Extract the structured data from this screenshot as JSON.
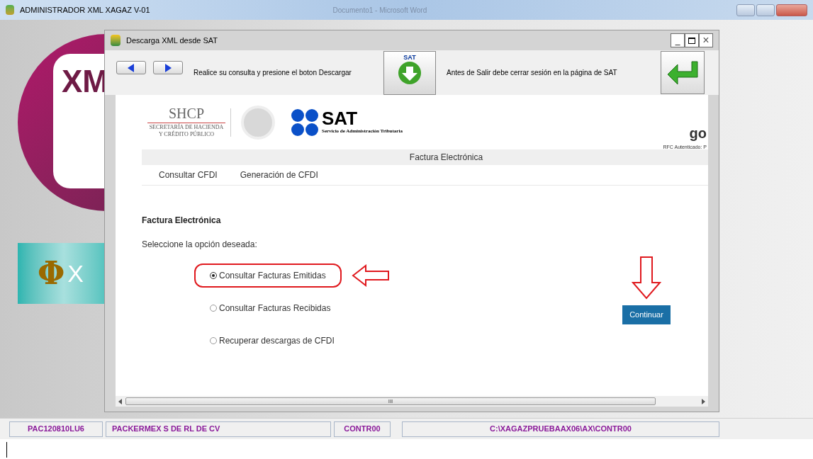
{
  "main_window": {
    "title": "ADMINISTRADOR XML XAGAZ V-01",
    "background_title": "Documento1 - Microsoft Word",
    "logo_text": "XM",
    "logo2_text": "X",
    "logo2_symbol": "Φ"
  },
  "dialog": {
    "title": "Descarga  XML desde SAT",
    "minimize": "_",
    "close": "×",
    "toolbar_hint": "Realice su consulta y presione el boton Descargar",
    "download_label": "SAT",
    "logout_hint": "Antes de Salir debe cerrar sesión en la página de SAT"
  },
  "web": {
    "shcp": "SHCP",
    "shcp_sub": "SECRETARÍA DE HACIENDA Y CRÉDITO PÚBLICO",
    "sat": "SAT",
    "sat_sub": "Servicio de Administración Tributaria",
    "cut_text": "go",
    "bar_title": "Factura Electrónica",
    "rfc": "RFC Autenticado: P",
    "menu": [
      {
        "label": "Consultar CFDI"
      },
      {
        "label": "Generación de CFDI"
      }
    ],
    "heading": "Factura Electrónica",
    "prompt": "Seleccione la opción deseada:",
    "options": [
      {
        "label": "Consultar Facturas Emitidas",
        "selected": true,
        "highlighted": true
      },
      {
        "label": "Consultar Facturas Recibidas",
        "selected": false,
        "highlighted": false
      },
      {
        "label": "Recuperar descargas de CFDI",
        "selected": false,
        "highlighted": false
      }
    ],
    "button": "Continuar",
    "scroll_grip": "III"
  },
  "status_bar": [
    {
      "text": "PAC120810LU6"
    },
    {
      "text": "PACKERMEX S DE RL DE CV"
    },
    {
      "text": "CONTR00"
    },
    {
      "text": "C:\\XAGAZPRUEBAAX06\\AX\\CONTR00"
    }
  ]
}
